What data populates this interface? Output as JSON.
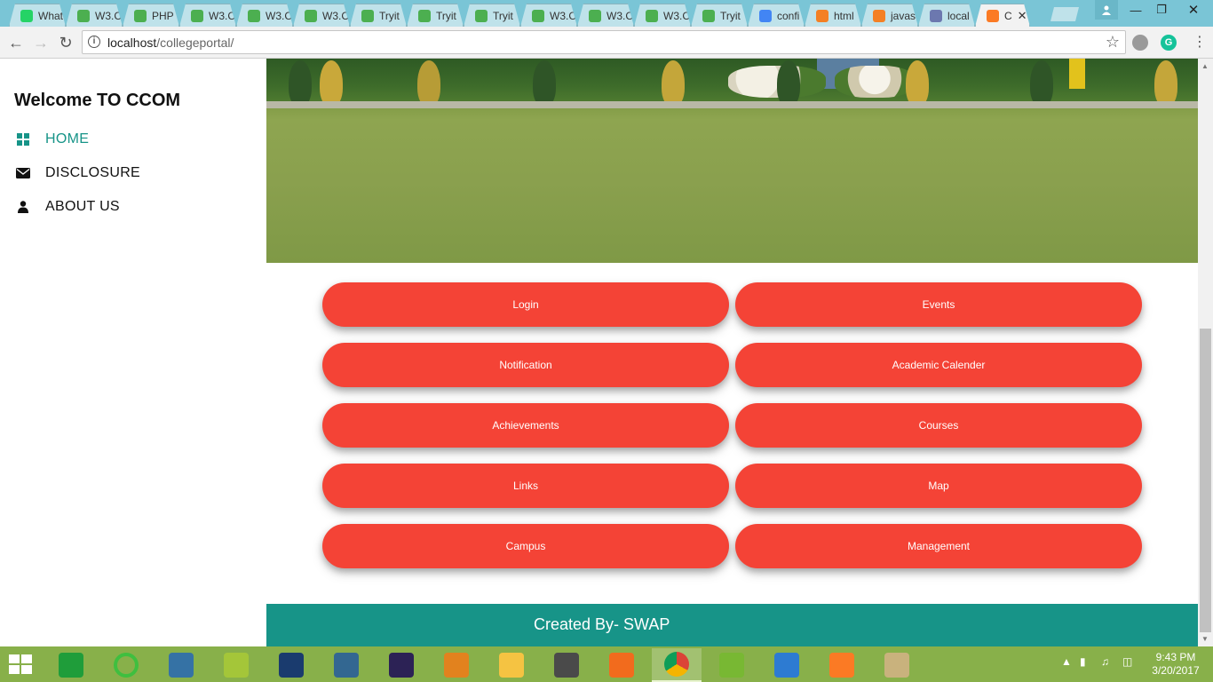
{
  "browser": {
    "tabs": [
      {
        "title": "What",
        "icon": "whatsapp-icon",
        "color": "#25d366"
      },
      {
        "title": "W3.C",
        "icon": "w3schools-icon",
        "color": "#4caf50"
      },
      {
        "title": "PHP",
        "icon": "w3schools-icon",
        "color": "#4caf50"
      },
      {
        "title": "W3.C",
        "icon": "w3schools-icon",
        "color": "#4caf50"
      },
      {
        "title": "W3.C",
        "icon": "w3schools-icon",
        "color": "#4caf50"
      },
      {
        "title": "W3.C",
        "icon": "w3schools-icon",
        "color": "#4caf50"
      },
      {
        "title": "Tryit",
        "icon": "w3schools-icon",
        "color": "#4caf50"
      },
      {
        "title": "Tryit",
        "icon": "w3schools-icon",
        "color": "#4caf50"
      },
      {
        "title": "Tryit",
        "icon": "w3schools-icon",
        "color": "#4caf50"
      },
      {
        "title": "W3.C",
        "icon": "w3schools-icon",
        "color": "#4caf50"
      },
      {
        "title": "W3.C",
        "icon": "w3schools-icon",
        "color": "#4caf50"
      },
      {
        "title": "W3.C",
        "icon": "w3schools-icon",
        "color": "#4caf50"
      },
      {
        "title": "Tryit",
        "icon": "w3schools-icon",
        "color": "#4caf50"
      },
      {
        "title": "confi",
        "icon": "google-icon",
        "color": "#4285f4"
      },
      {
        "title": "html",
        "icon": "stackoverflow-icon",
        "color": "#f48024"
      },
      {
        "title": "javas",
        "icon": "stackoverflow-icon",
        "color": "#f48024"
      },
      {
        "title": "local",
        "icon": "phpmyadmin-icon",
        "color": "#6c78af"
      },
      {
        "title": "C",
        "icon": "xampp-icon",
        "color": "#fb7a24",
        "active": true
      }
    ],
    "url": {
      "host": "localhost",
      "path": "/collegeportal/"
    }
  },
  "sidebar": {
    "welcome": "Welcome TO CCOM",
    "items": [
      {
        "label": "HOME",
        "icon": "grid-icon"
      },
      {
        "label": "DISCLOSURE",
        "icon": "envelope-icon"
      },
      {
        "label": "ABOUT US",
        "icon": "user-icon"
      }
    ]
  },
  "buttons": {
    "login": "Login",
    "events": "Events",
    "notification": "Notification",
    "academic_calender": "Academic Calender",
    "achievements": "Achievements",
    "courses": "Courses",
    "links": "Links",
    "map": "Map",
    "campus": "Campus",
    "management": "Management"
  },
  "footer": {
    "credit": "Created By- SWAP"
  },
  "colors": {
    "accent": "#179488",
    "button": "#f44336",
    "taskbar": "#88b04a"
  },
  "taskbar": {
    "apps": [
      "store-icon",
      "circle-app-icon",
      "python-icon",
      "android-studio-icon",
      "motorola-icon",
      "postgres-icon",
      "eclipse-icon",
      "mysql-workbench-icon",
      "file-explorer-icon",
      "sublime-icon",
      "uc-browser-icon",
      "chrome-icon",
      "utorrent-icon",
      "idm-icon",
      "xampp-icon",
      "paint-icon"
    ],
    "time": "9:43 PM",
    "date": "3/20/2017"
  }
}
